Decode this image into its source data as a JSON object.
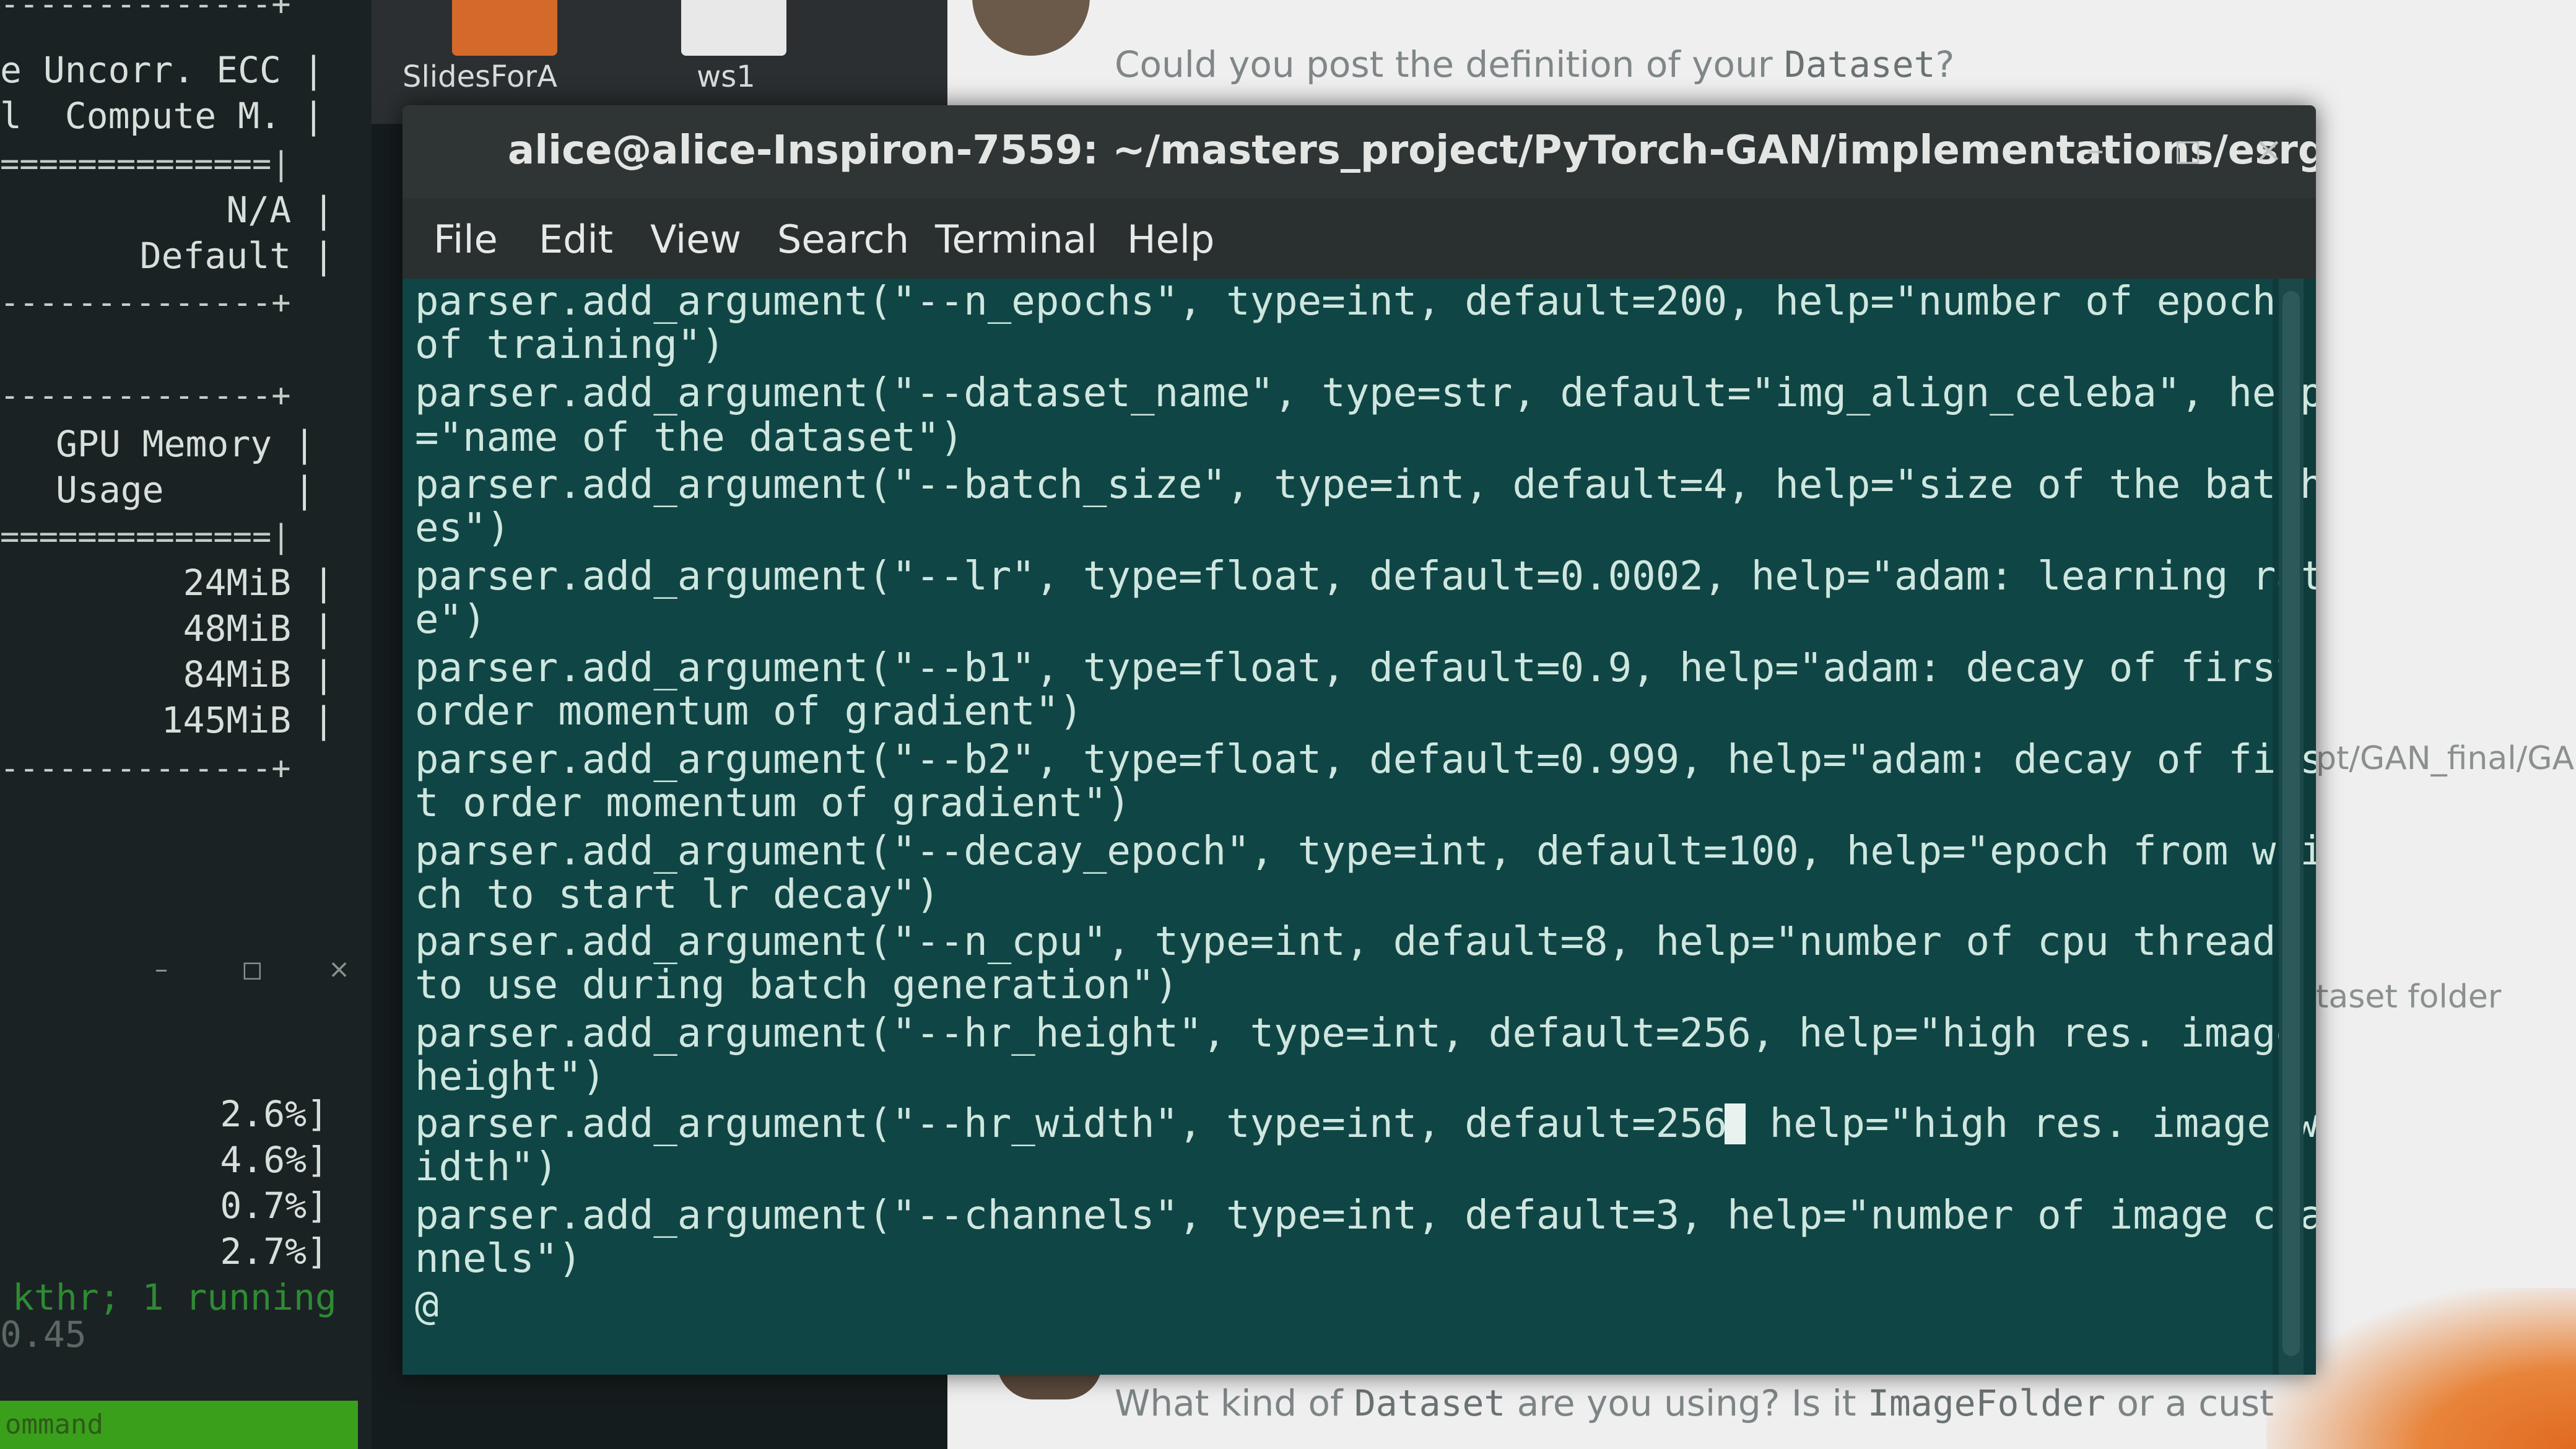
{
  "left_terminal": {
    "rule_top": "--------------+",
    "lines_top": [
      "e Uncorr. ECC |",
      "l  Compute M. |"
    ],
    "rule_double_1": "==============|",
    "lines_mid": [
      "N/A |",
      "Default |"
    ],
    "rule_mid": "--------------+",
    "rule_mid2": "--------------+",
    "gpu_mem_header": [
      "GPU Memory |",
      "Usage      |"
    ],
    "rule_double_2": "==============|",
    "mem_values": [
      "24MiB |",
      "48MiB |",
      "84MiB |",
      "145MiB |"
    ],
    "rule_bottom": "--------------+",
    "window_controls": [
      "–",
      "◻",
      "×"
    ],
    "cpu_values": [
      "2.6%]",
      "4.6%]",
      "0.7%]",
      "2.7%]"
    ],
    "tasks_line": "kthr; 1 running",
    "load_line": "0.45",
    "command_bar": "ommand"
  },
  "desktop": {
    "icons": [
      {
        "label": "SlidesForA",
        "color": "#d46a2a"
      },
      {
        "label": "ws1",
        "color": "#e8e8e8"
      }
    ]
  },
  "browser": {
    "question_prefix": "Could you post the definition of your ",
    "question_code": "Dataset",
    "question_suffix": "?",
    "side_snippets": [
      "pt/GAN_final/GA",
      "taset folder"
    ],
    "answer_prefix": "What kind of ",
    "answer_code1": "Dataset",
    "answer_mid": " are you using? Is it ",
    "answer_code2": "ImageFolder",
    "answer_suffix": " or a cust"
  },
  "terminal": {
    "title": "alice@alice-Inspiron-7559: ~/masters_project/PyTorch-GAN/implementations/esrgan",
    "window_buttons": {
      "minimize": "–",
      "maximize": "◻",
      "close": "×"
    },
    "menu": [
      "File",
      "Edit",
      "View",
      "Search",
      "Terminal",
      "Help"
    ],
    "lines": [
      "parser.add_argument(\"--n_epochs\", type=int, default=200, help=\"number of epochs",
      "of training\")",
      "parser.add_argument(\"--dataset_name\", type=str, default=\"img_align_celeba\", help",
      "=\"name of the dataset\")",
      "parser.add_argument(\"--batch_size\", type=int, default=4, help=\"size of the batch",
      "es\")",
      "parser.add_argument(\"--lr\", type=float, default=0.0002, help=\"adam: learning rat",
      "e\")",
      "parser.add_argument(\"--b1\", type=float, default=0.9, help=\"adam: decay of first",
      "order momentum of gradient\")",
      "parser.add_argument(\"--b2\", type=float, default=0.999, help=\"adam: decay of firs",
      "t order momentum of gradient\")",
      "parser.add_argument(\"--decay_epoch\", type=int, default=100, help=\"epoch from whi",
      "ch to start lr decay\")",
      "parser.add_argument(\"--n_cpu\", type=int, default=8, help=\"number of cpu threads",
      "to use during batch generation\")",
      "parser.add_argument(\"--hr_height\", type=int, default=256, help=\"high res. image",
      "height\")",
      "parser.add_argument(\"--hr_width\", type=int, default=256",
      "idth\")",
      "parser.add_argument(\"--channels\", type=int, default=3, help=\"number of image cha",
      "nnels\")",
      "@"
    ],
    "cursor_line_after": " help=\"high res. image w"
  }
}
